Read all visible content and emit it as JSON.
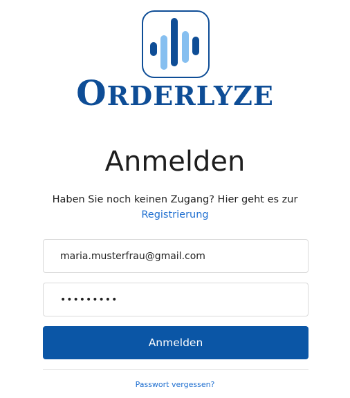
{
  "logo": {
    "icon": "sound-wave-bars-icon",
    "brand_first": "O",
    "brand_rest": "RDERLYZE",
    "primary_color": "#0e4d96",
    "secondary_color": "#86bff0"
  },
  "login": {
    "heading": "Anmelden",
    "no_account_text": "Haben Sie noch keinen Zugang? Hier geht es zur",
    "register_link": "Registrierung",
    "email_value": "maria.musterfrau@gmail.com",
    "password_value": "•••••••••",
    "submit_label": "Anmelden",
    "forgot_password_link": "Passwort vergessen?",
    "accent_color": "#0b56a6",
    "link_color": "#1f6fd0"
  }
}
